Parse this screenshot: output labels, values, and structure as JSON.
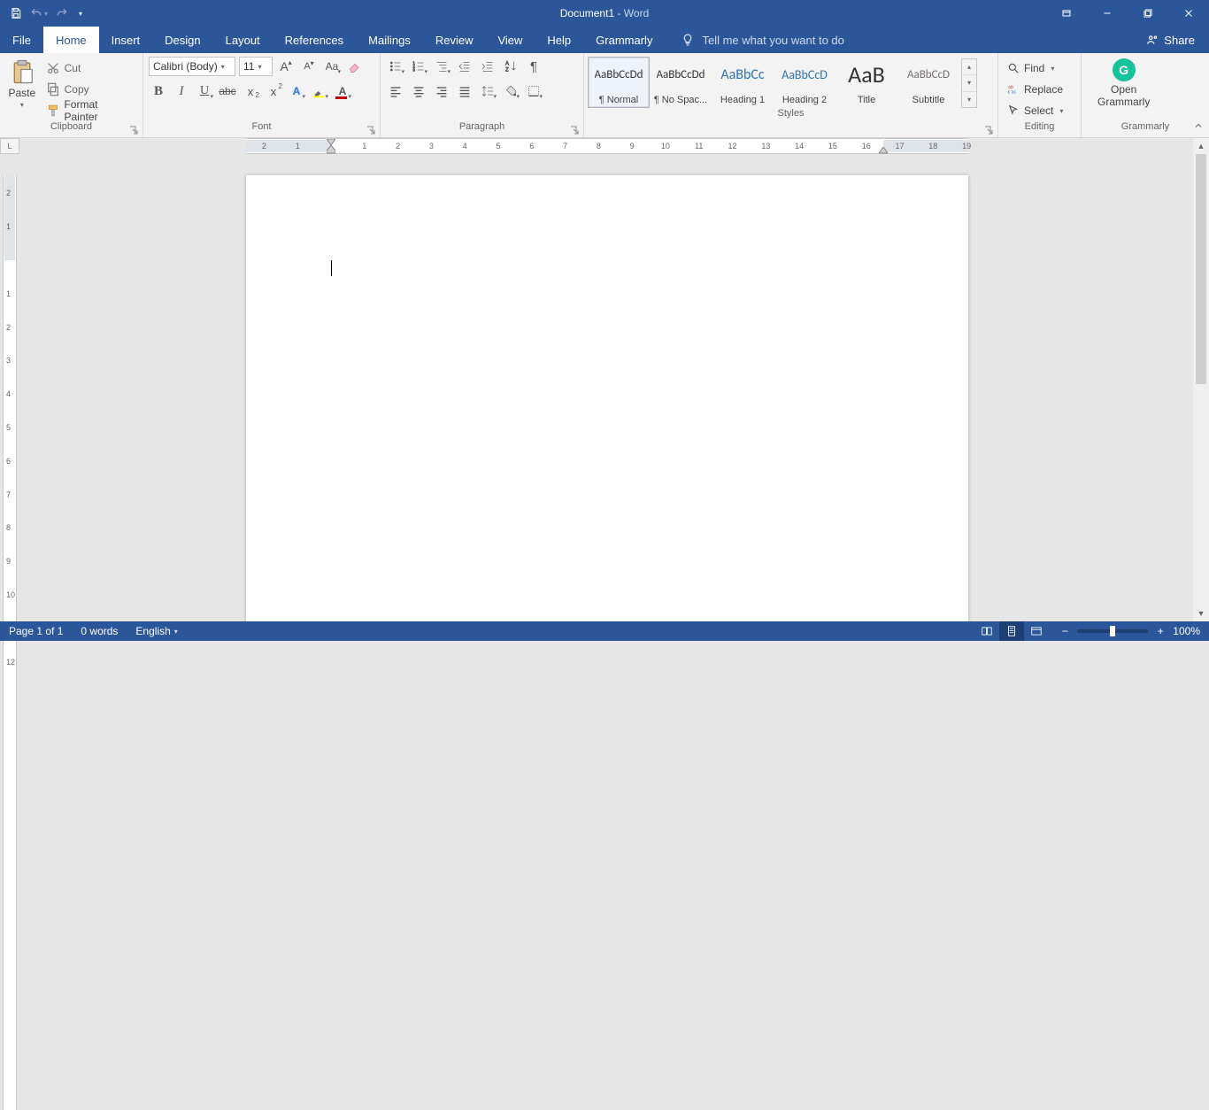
{
  "titlebar": {
    "document_name": "Document1",
    "separator": "  -  ",
    "app_name": "Word"
  },
  "tabs": {
    "file": "File",
    "items": [
      "Home",
      "Insert",
      "Design",
      "Layout",
      "References",
      "Mailings",
      "Review",
      "View",
      "Help",
      "Grammarly"
    ],
    "active_index": 0,
    "tellme": "Tell me what you want to do",
    "share": "Share"
  },
  "ribbon": {
    "clipboard": {
      "label": "Clipboard",
      "paste": "Paste",
      "cut": "Cut",
      "copy": "Copy",
      "format_painter": "Format Painter"
    },
    "font": {
      "label": "Font",
      "name": "Calibri (Body)",
      "size": "11",
      "case": "Aa"
    },
    "paragraph": {
      "label": "Paragraph"
    },
    "styles": {
      "label": "Styles",
      "items": [
        {
          "preview": "AaBbCcDd",
          "name": "¶ Normal",
          "size": 13,
          "color": "#333"
        },
        {
          "preview": "AaBbCcDd",
          "name": "¶ No Spac...",
          "size": 13,
          "color": "#333"
        },
        {
          "preview": "AaBbCc",
          "name": "Heading 1",
          "size": 16,
          "color": "#2e74b5"
        },
        {
          "preview": "AaBbCcD",
          "name": "Heading 2",
          "size": 14,
          "color": "#2e74b5"
        },
        {
          "preview": "AaB",
          "name": "Title",
          "size": 26,
          "color": "#333"
        },
        {
          "preview": "AaBbCcD",
          "name": "Subtitle",
          "size": 13,
          "color": "#767171"
        }
      ],
      "selected": 0
    },
    "editing": {
      "label": "Editing",
      "find": "Find",
      "replace": "Replace",
      "select": "Select"
    },
    "grammarly": {
      "label": "Grammarly",
      "open_line1": "Open",
      "open_line2": "Grammarly"
    }
  },
  "ruler": {
    "corner": "L",
    "h_numbers": [
      2,
      1,
      1,
      2,
      3,
      4,
      5,
      6,
      7,
      8,
      9,
      10,
      11,
      12,
      13,
      14,
      15,
      16,
      17,
      18,
      19
    ],
    "v_numbers": [
      2,
      1,
      1,
      2,
      3,
      4,
      5,
      6,
      7,
      8,
      9,
      10
    ]
  },
  "statusbar": {
    "page": "Page 1 of 1",
    "words": "0 words",
    "language": "English",
    "zoom": "100%"
  }
}
